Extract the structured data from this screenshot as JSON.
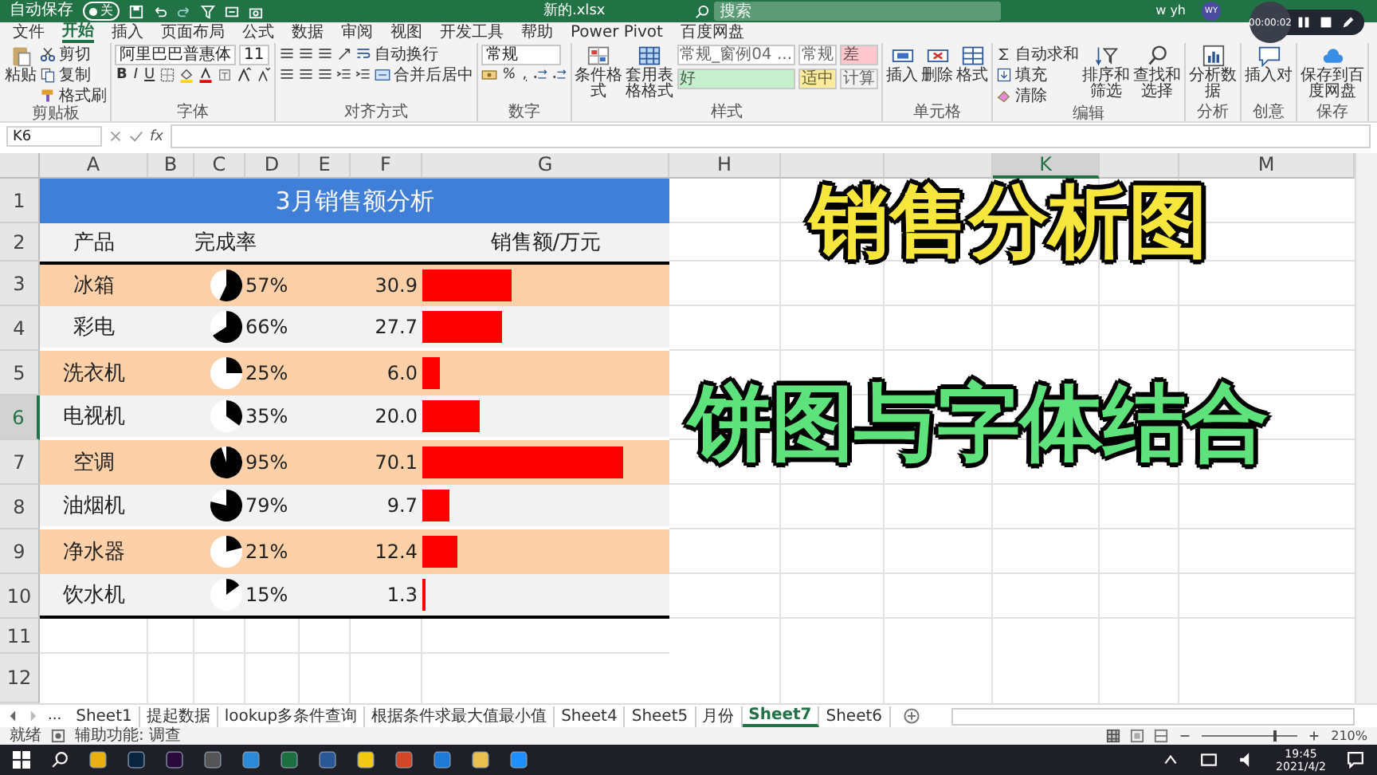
{
  "title_bar": {
    "autosave_label": "自动保存",
    "autosave_toggle": {
      "text": "关",
      "on": false
    },
    "file_name": "新的.xlsx",
    "search": {
      "placeholder": "搜索"
    },
    "user_name": "w yh",
    "avatar": "WY"
  },
  "recorder": {
    "time": "00:00:02"
  },
  "ribbon_tabs": [
    {
      "label": "文件",
      "selected": false
    },
    {
      "label": "开始",
      "selected": true
    },
    {
      "label": "插入",
      "selected": false
    },
    {
      "label": "页面布局",
      "selected": false
    },
    {
      "label": "公式",
      "selected": false
    },
    {
      "label": "数据",
      "selected": false
    },
    {
      "label": "审阅",
      "selected": false
    },
    {
      "label": "视图",
      "selected": false
    },
    {
      "label": "开发工具",
      "selected": false
    },
    {
      "label": "帮助",
      "selected": false
    },
    {
      "label": "Power Pivot",
      "selected": false
    },
    {
      "label": "百度网盘",
      "selected": false
    }
  ],
  "ribbon": [
    {
      "name": "剪贴板",
      "parts": [
        {
          "kind": "paste",
          "label": "粘贴"
        },
        {
          "kind": "stack",
          "lines": [
            {
              "items": [
                {
                  "kind": "cut",
                  "label": "剪切"
                }
              ]
            },
            {
              "items": [
                {
                  "kind": "copy",
                  "label": "复制"
                }
              ]
            },
            {
              "items": [
                {
                  "kind": "brush",
                  "label": "格式刷"
                }
              ]
            }
          ]
        }
      ]
    },
    {
      "name": "字体",
      "parts": [
        {
          "kind": "stack",
          "lines": [
            {
              "items": [
                {
                  "kind": "font",
                  "value": "阿里巴巴普惠体"
                },
                {
                  "kind": "size",
                  "value": "11"
                }
              ]
            },
            {
              "items": [
                {
                  "kind": "text",
                  "label": "B"
                },
                {
                  "kind": "text",
                  "label": "I"
                },
                {
                  "kind": "text",
                  "label": "U"
                },
                {
                  "kind": "border"
                },
                {
                  "kind": "fill"
                },
                {
                  "kind": "fontcolor"
                },
                {
                  "kind": "phonetic"
                },
                {
                  "kind": "grow"
                },
                {
                  "kind": "shrink"
                }
              ]
            }
          ]
        }
      ]
    },
    {
      "name": "对齐方式",
      "parts": [
        {
          "kind": "stack",
          "lines": [
            {
              "items": [
                {
                  "kind": "align"
                },
                {
                  "kind": "align"
                },
                {
                  "kind": "align"
                },
                {
                  "kind": "orient"
                },
                {
                  "kind": "wrap",
                  "label": "自动换行"
                }
              ]
            },
            {
              "items": [
                {
                  "kind": "align"
                },
                {
                  "kind": "align"
                },
                {
                  "kind": "align"
                },
                {
                  "kind": "indent"
                },
                {
                  "kind": "indent"
                },
                {
                  "kind": "merge",
                  "label": "合并后居中"
                }
              ]
            }
          ]
        }
      ]
    },
    {
      "name": "数字",
      "parts": [
        {
          "kind": "stack",
          "lines": [
            {
              "items": [
                {
                  "kind": "numfmt",
                  "value": "常规"
                }
              ]
            },
            {
              "items": [
                {
                  "kind": "currency"
                },
                {
                  "kind": "text",
                  "label": "%"
                },
                {
                  "kind": "text",
                  "label": ","
                },
                {
                  "kind": "decimal"
                },
                {
                  "kind": "decimal"
                }
              ]
            }
          ]
        }
      ]
    },
    {
      "name": "样式",
      "parts": [
        {
          "kind": "cond",
          "label": "条件格式"
        },
        {
          "kind": "table",
          "label": "套用表格格式"
        },
        {
          "kind": "gallery",
          "items": [
            {
              "label": "常规_窗例04 ...",
              "color": "#ffffff"
            },
            {
              "label": "常规",
              "color": "#ffffff"
            },
            {
              "label": "差",
              "color": "#ffc7ce"
            },
            {
              "label": "好",
              "color": "#c6efce"
            },
            {
              "label": "适中",
              "color": "#ffeb9c"
            },
            {
              "label": "计算",
              "color": "#f2f2f2"
            }
          ]
        }
      ]
    },
    {
      "name": "单元格",
      "parts": [
        {
          "kind": "insert",
          "label": "插入"
        },
        {
          "kind": "delete",
          "label": "删除"
        },
        {
          "kind": "format",
          "label": "格式"
        }
      ]
    },
    {
      "name": "编辑",
      "parts": [
        {
          "kind": "stack",
          "lines": [
            {
              "items": [
                {
                  "kind": "sum",
                  "label": "自动求和"
                }
              ]
            },
            {
              "items": [
                {
                  "kind": "filldown",
                  "label": "填充"
                }
              ]
            },
            {
              "items": [
                {
                  "kind": "clear",
                  "label": "清除"
                }
              ]
            }
          ]
        },
        {
          "kind": "sort",
          "label": "排序和筛选"
        },
        {
          "kind": "find",
          "label": "查找和选择"
        }
      ]
    },
    {
      "name": "分析",
      "parts": [
        {
          "kind": "analyze",
          "label": "分析数据"
        }
      ]
    },
    {
      "name": "创意",
      "parts": [
        {
          "kind": "comment",
          "label": "插入对"
        }
      ]
    },
    {
      "name": "保存",
      "parts": [
        {
          "kind": "cloud",
          "label": "保存到百度网盘"
        }
      ]
    }
  ],
  "formula_bar": {
    "name_box": "K6",
    "fx": "fx"
  },
  "columns": [
    {
      "label": "A",
      "selected": false
    },
    {
      "label": "B",
      "selected": false
    },
    {
      "label": "C",
      "selected": false
    },
    {
      "label": "D",
      "selected": false
    },
    {
      "label": "E",
      "selected": false
    },
    {
      "label": "F",
      "selected": false
    },
    {
      "label": "G",
      "selected": false
    },
    {
      "label": "H",
      "selected": false
    }
  ],
  "columns_right": [
    {
      "label": "K",
      "selected": true
    },
    {
      "label": "M",
      "selected": false
    }
  ],
  "row_headers": [
    {
      "label": "1",
      "selected": false
    },
    {
      "label": "2",
      "selected": false
    },
    {
      "label": "3",
      "selected": false
    },
    {
      "label": "4",
      "selected": false
    },
    {
      "label": "5",
      "selected": false
    },
    {
      "label": "6",
      "selected": true
    },
    {
      "label": "7",
      "selected": false
    },
    {
      "label": "8",
      "selected": false
    },
    {
      "label": "9",
      "selected": false
    },
    {
      "label": "10",
      "selected": false
    },
    {
      "label": "11",
      "selected": false
    },
    {
      "label": "12",
      "selected": false
    }
  ],
  "sheet": {
    "title": "3月销售额分析",
    "headers": {
      "product": "产品",
      "completion": "完成率",
      "sales": "销售额/万元"
    },
    "products": [
      {
        "name": "冰箱",
        "shaded": true,
        "completion": "57%",
        "sales": "30.9"
      },
      {
        "name": "彩电",
        "shaded": false,
        "completion": "66%",
        "sales": "27.7"
      },
      {
        "name": "洗衣机",
        "shaded": true,
        "completion": "25%",
        "sales": "6.0"
      },
      {
        "name": "电视机",
        "shaded": false,
        "completion": "35%",
        "sales": "20.0"
      },
      {
        "name": "空调",
        "shaded": true,
        "completion": "95%",
        "sales": "70.1"
      },
      {
        "name": "油烟机",
        "shaded": false,
        "completion": "79%",
        "sales": "9.7"
      },
      {
        "name": "净水器",
        "shaded": true,
        "completion": "21%",
        "sales": "12.4"
      },
      {
        "name": "饮水机",
        "shaded": false,
        "completion": "15%",
        "sales": "1.3"
      }
    ]
  },
  "overlay_titles": [
    {
      "text": "销售分析图",
      "color": "#f7e63c"
    },
    {
      "text": "饼图与字体结合",
      "color": "#5ee37c"
    }
  ],
  "sheet_tabs_overflow": "...",
  "sheet_tabs": [
    {
      "label": "Sheet1",
      "selected": false
    },
    {
      "label": "提起数据",
      "selected": false
    },
    {
      "label": "lookup多条件查询",
      "selected": false
    },
    {
      "label": "根据条件求最大值最小值",
      "selected": false
    },
    {
      "label": "Sheet4",
      "selected": false
    },
    {
      "label": "Sheet5",
      "selected": false
    },
    {
      "label": "月份",
      "selected": false
    },
    {
      "label": "Sheet7",
      "selected": true
    },
    {
      "label": "Sheet6",
      "selected": false
    }
  ],
  "status_bar": {
    "status": "就绪",
    "accessibility": "辅助功能: 调查",
    "zoom": {
      "text": "210%",
      "level": 0.75
    }
  },
  "taskbar": {
    "time": "19:45",
    "date": "2021/4/2"
  }
}
